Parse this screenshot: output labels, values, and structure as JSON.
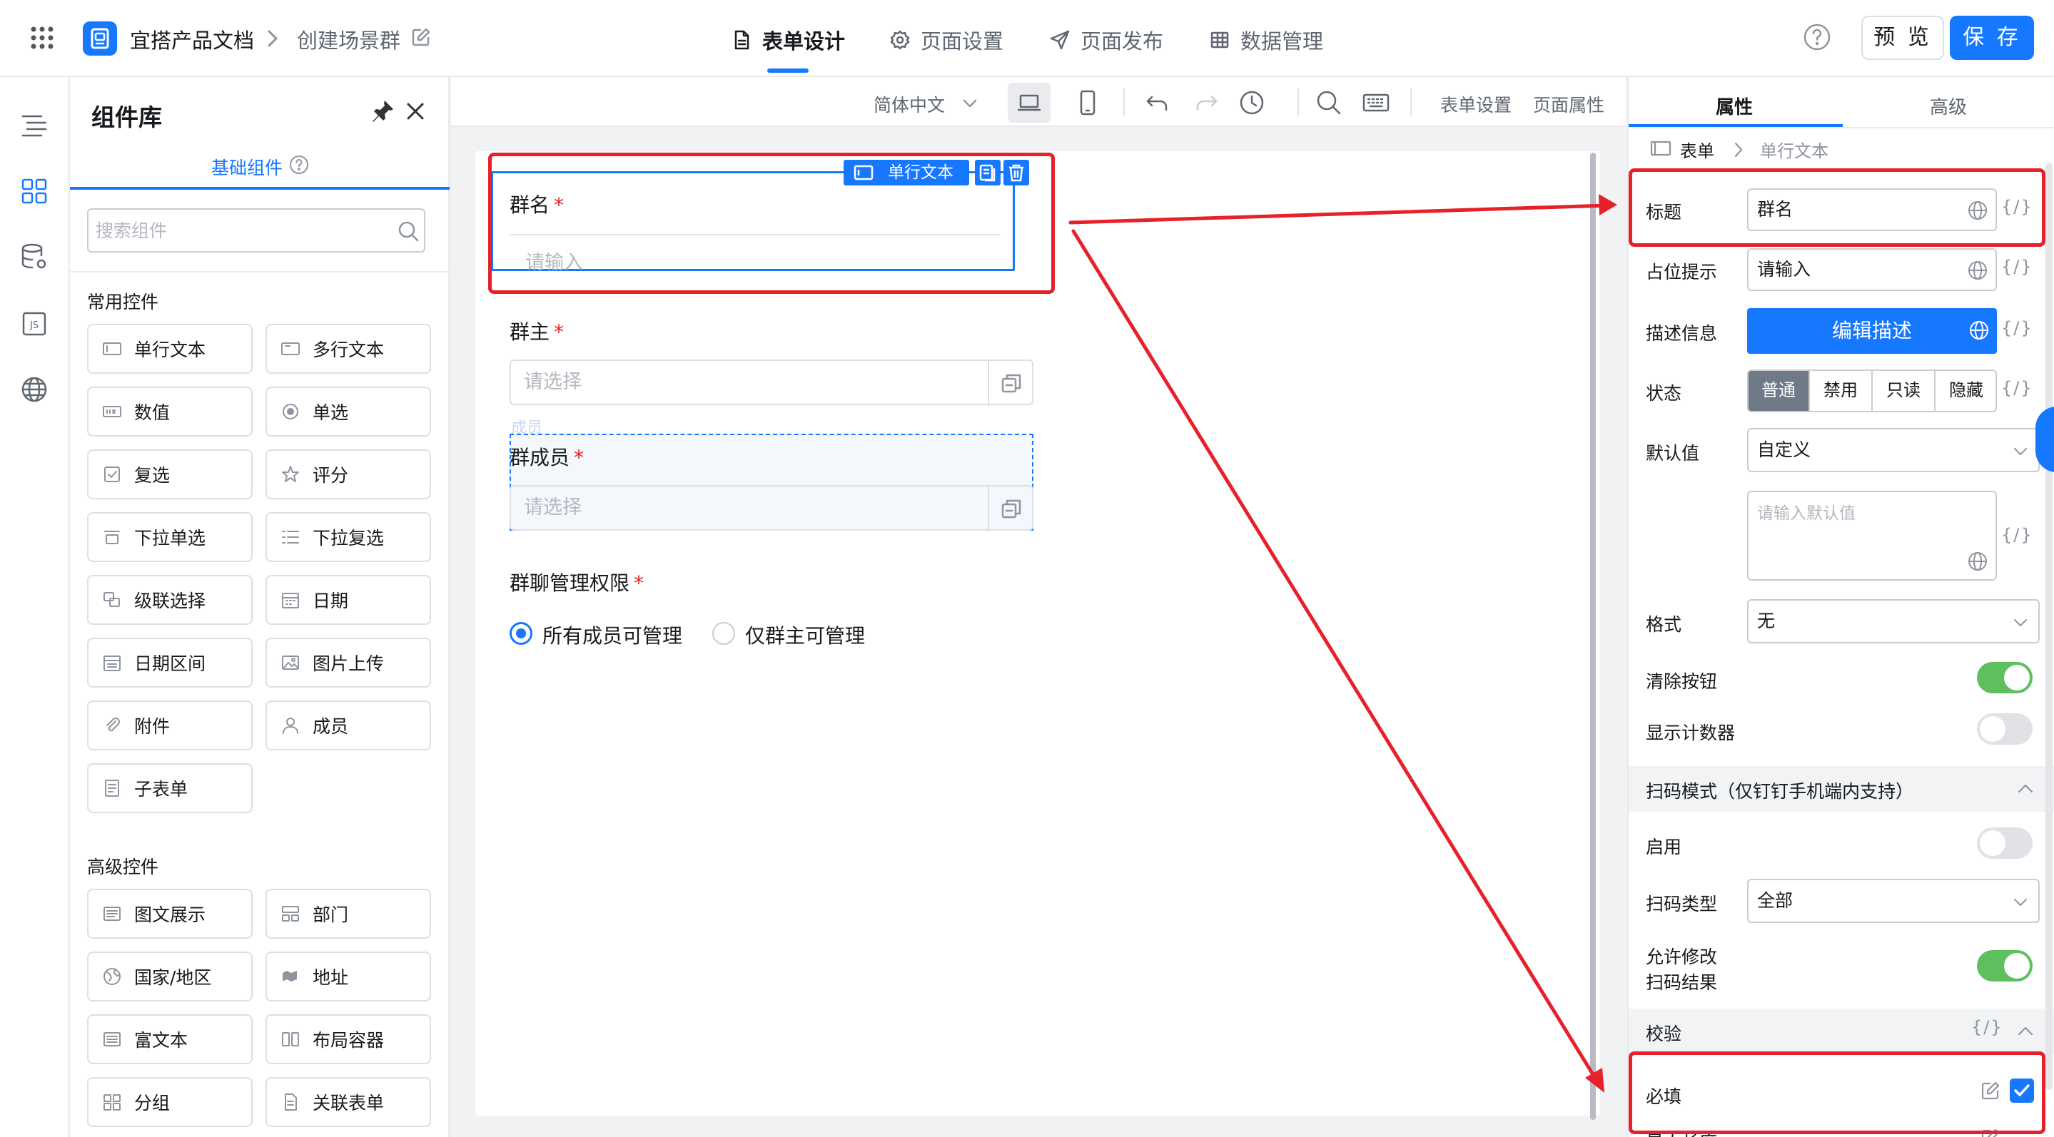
{
  "topbar": {
    "app_name": "宜搭产品文档",
    "page_name": "创建场景群",
    "tabs": [
      {
        "label": "表单设计",
        "icon": "document-icon",
        "active": true
      },
      {
        "label": "页面设置",
        "icon": "gear-icon",
        "active": false
      },
      {
        "label": "页面发布",
        "icon": "send-icon",
        "active": false
      },
      {
        "label": "数据管理",
        "icon": "table-icon",
        "active": false
      }
    ],
    "preview_label": "预 览",
    "save_label": "保 存",
    "accent_color": "#1677ff"
  },
  "rail": {
    "items": [
      "outline-icon",
      "components-icon",
      "datasource-icon",
      "js-icon",
      "globe-icon"
    ],
    "js_label": "JS"
  },
  "library": {
    "title": "组件库",
    "tab_label": "基础组件",
    "search_placeholder": "搜索组件",
    "common_group": "常用控件",
    "common_items": [
      {
        "label": "单行文本",
        "icon": "input-icon"
      },
      {
        "label": "多行文本",
        "icon": "textarea-icon"
      },
      {
        "label": "数值",
        "icon": "number-icon"
      },
      {
        "label": "单选",
        "icon": "radio-icon"
      },
      {
        "label": "复选",
        "icon": "checkbox-icon"
      },
      {
        "label": "评分",
        "icon": "star-icon"
      },
      {
        "label": "下拉单选",
        "icon": "select-icon"
      },
      {
        "label": "下拉复选",
        "icon": "multiselect-icon"
      },
      {
        "label": "级联选择",
        "icon": "cascade-icon"
      },
      {
        "label": "日期",
        "icon": "calendar-icon"
      },
      {
        "label": "日期区间",
        "icon": "date-range-icon"
      },
      {
        "label": "图片上传",
        "icon": "image-icon"
      },
      {
        "label": "附件",
        "icon": "paperclip-icon"
      },
      {
        "label": "成员",
        "icon": "user-icon"
      },
      {
        "label": "子表单",
        "icon": "subform-icon"
      }
    ],
    "advanced_group": "高级控件",
    "advanced_items": [
      {
        "label": "图文展示",
        "icon": "rich-display-icon"
      },
      {
        "label": "部门",
        "icon": "department-icon"
      },
      {
        "label": "国家/地区",
        "icon": "globe-icon"
      },
      {
        "label": "地址",
        "icon": "map-icon"
      },
      {
        "label": "富文本",
        "icon": "richtext-icon"
      },
      {
        "label": "布局容器",
        "icon": "layout-icon"
      },
      {
        "label": "分组",
        "icon": "group-icon"
      },
      {
        "label": "关联表单",
        "icon": "link-form-icon"
      }
    ]
  },
  "toolbar": {
    "language": "简体中文",
    "form_settings": "表单设置",
    "page_props": "页面属性"
  },
  "form": {
    "selected_tag": "单行文本",
    "fields": {
      "group_name": {
        "label": "群名",
        "placeholder": "请输入"
      },
      "group_owner": {
        "label": "群主",
        "placeholder": "请选择"
      },
      "ghost_label": "成员",
      "group_members": {
        "label": "群成员",
        "placeholder": "请选择"
      },
      "permission": {
        "label": "群聊管理权限",
        "options": [
          "所有成员可管理",
          "仅群主可管理"
        ],
        "selected": 0
      }
    },
    "required_mark": "*"
  },
  "props": {
    "tab_attr": "属性",
    "tab_adv": "高级",
    "crumb_root": "表单",
    "crumb_leaf": "单行文本",
    "var_label": "{/}",
    "title_label": "标题",
    "title_value": "群名",
    "placeholder_label": "占位提示",
    "placeholder_value": "请输入",
    "desc_label": "描述信息",
    "desc_button": "编辑描述",
    "state_label": "状态",
    "state_options": [
      "普通",
      "禁用",
      "只读",
      "隐藏"
    ],
    "state_selected": 0,
    "default_label": "默认值",
    "default_mode": "自定义",
    "default_placeholder": "请输入默认值",
    "format_label": "格式",
    "format_value": "无",
    "clear_label": "清除按钮",
    "clear_on": true,
    "counter_label": "显示计数器",
    "counter_on": false,
    "scan_section": "扫码模式（仅钉钉手机端内支持）",
    "scan_enable_label": "启用",
    "scan_enable_on": false,
    "scan_type_label": "扫码类型",
    "scan_type_value": "全部",
    "allow_edit_label_1": "允许修改",
    "allow_edit_label_2": "扫码结果",
    "allow_edit_on": true,
    "validate_section": "校验",
    "required_label": "必填",
    "required_checked": true,
    "maxlen_label": "最大长度"
  },
  "annotation_color": "#e6212a"
}
